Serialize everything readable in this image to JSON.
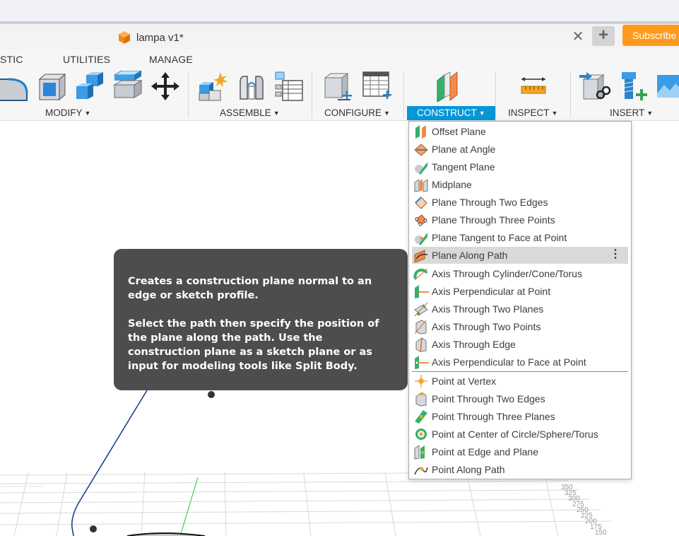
{
  "document": {
    "title": "lampa v1*"
  },
  "header": {
    "close_glyph": "✕",
    "new_tab_glyph": "+",
    "subscribe_label": "Subscribe"
  },
  "workspace_tabs": [
    "STIC",
    "UTILITIES",
    "MANAGE"
  ],
  "toolbar": {
    "groups": [
      {
        "label": "MODIFY"
      },
      {
        "label": "ASSEMBLE"
      },
      {
        "label": "CONFIGURE"
      },
      {
        "label": "CONSTRUCT"
      },
      {
        "label": "INSPECT"
      },
      {
        "label": "INSERT"
      }
    ],
    "caret": "▼"
  },
  "construct_menu": {
    "items": [
      {
        "label": "Offset Plane",
        "icon": "offset-plane-icon"
      },
      {
        "label": "Plane at Angle",
        "icon": "plane-at-angle-icon"
      },
      {
        "label": "Tangent Plane",
        "icon": "tangent-plane-icon"
      },
      {
        "label": "Midplane",
        "icon": "midplane-icon"
      },
      {
        "label": "Plane Through Two Edges",
        "icon": "plane-two-edges-icon"
      },
      {
        "label": "Plane Through Three Points",
        "icon": "plane-three-points-icon"
      },
      {
        "label": "Plane Tangent to Face at Point",
        "icon": "plane-tangent-face-icon"
      },
      {
        "label": "Plane Along Path",
        "icon": "plane-along-path-icon",
        "highlighted": true
      },
      {
        "label": "Axis Through Cylinder/Cone/Torus",
        "icon": "axis-cylinder-icon"
      },
      {
        "label": "Axis Perpendicular at Point",
        "icon": "axis-perpendicular-icon"
      },
      {
        "label": "Axis Through Two Planes",
        "icon": "axis-two-planes-icon"
      },
      {
        "label": "Axis Through Two Points",
        "icon": "axis-two-points-icon"
      },
      {
        "label": "Axis Through Edge",
        "icon": "axis-edge-icon"
      },
      {
        "label": "Axis Perpendicular to Face at Point",
        "icon": "axis-perp-face-icon"
      },
      {
        "label": "Point at Vertex",
        "icon": "point-vertex-icon"
      },
      {
        "label": "Point Through Two Edges",
        "icon": "point-two-edges-icon"
      },
      {
        "label": "Point Through Three Planes",
        "icon": "point-three-planes-icon"
      },
      {
        "label": "Point at Center of Circle/Sphere/Torus",
        "icon": "point-center-icon"
      },
      {
        "label": "Point at Edge and Plane",
        "icon": "point-edge-plane-icon"
      },
      {
        "label": "Point Along Path",
        "icon": "point-along-path-icon"
      }
    ],
    "more_glyph": "⋮"
  },
  "tooltip": {
    "para1": "Creates a construction plane normal to an edge or sketch profile.",
    "para2": "Select the path then specify the position of the plane along the path. Use the construction plane as a sketch plane or as input for modeling tools like Split Body."
  },
  "canvas": {
    "ruler_labels": [
      "350",
      "325",
      "300",
      "275",
      "250",
      "225",
      "200",
      "175",
      "150"
    ]
  },
  "colors": {
    "accent": "#0696d7",
    "subscribe": "#ff9a1e",
    "tooltip_bg": "#4d4d4d"
  }
}
